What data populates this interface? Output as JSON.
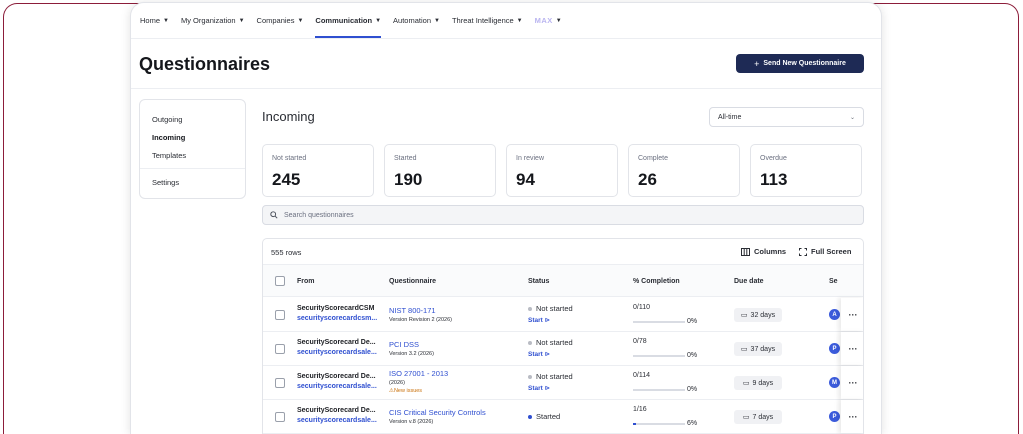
{
  "nav": {
    "items": [
      {
        "label": "Home"
      },
      {
        "label": "My Organization"
      },
      {
        "label": "Companies"
      },
      {
        "label": "Communication"
      },
      {
        "label": "Automation"
      },
      {
        "label": "Threat Intelligence"
      },
      {
        "label": "MAX"
      }
    ],
    "active": "Communication"
  },
  "page": {
    "title": "Questionnaires",
    "send_button": "Send New Questionnaire"
  },
  "sidebar": {
    "items": [
      {
        "label": "Outgoing"
      },
      {
        "label": "Incoming"
      },
      {
        "label": "Templates"
      },
      {
        "label": "Settings"
      }
    ],
    "active": "Incoming"
  },
  "main": {
    "title": "Incoming",
    "range": "All-time",
    "stats": [
      {
        "label": "Not started",
        "value": "245"
      },
      {
        "label": "Started",
        "value": "190"
      },
      {
        "label": "In review",
        "value": "94"
      },
      {
        "label": "Complete",
        "value": "26"
      },
      {
        "label": "Overdue",
        "value": "113"
      }
    ],
    "search_placeholder": "Search questionnaires"
  },
  "table": {
    "rows_count": "555 rows",
    "columns_button": "Columns",
    "fullscreen_button": "Full Screen",
    "headers": [
      "From",
      "Questionnaire",
      "Status",
      "% Completion",
      "Due date",
      "Se"
    ],
    "rows": [
      {
        "from_name": "SecurityScorecardCSM",
        "from_mail": "securityscorecardcsm...",
        "q_name": "NIST 800-171",
        "q_ver": "Version Revision 2 (2026)",
        "q_warn": "",
        "status": "Not started",
        "start": "Start ⊳",
        "count": "0/110",
        "pct": "0%",
        "progress": 0,
        "due": "32 days",
        "avatar": "A"
      },
      {
        "from_name": "SecurityScorecard De...",
        "from_mail": "securityscorecardsale...",
        "q_name": "PCI DSS",
        "q_ver": "Version 3.2 (2026)",
        "q_warn": "",
        "status": "Not started",
        "start": "Start ⊳",
        "count": "0/78",
        "pct": "0%",
        "progress": 0,
        "due": "37 days",
        "avatar": "P"
      },
      {
        "from_name": "SecurityScorecard De...",
        "from_mail": "securityscorecardsale...",
        "q_name": "ISO 27001 - 2013",
        "q_ver": "(2026)",
        "q_warn": "New issues",
        "status": "Not started",
        "start": "Start ⊳",
        "count": "0/114",
        "pct": "0%",
        "progress": 0,
        "due": "9 days",
        "avatar": "M"
      },
      {
        "from_name": "SecurityScorecard De...",
        "from_mail": "securityscorecardsale...",
        "q_name": "CIS Critical Security Controls",
        "q_ver": "Version v.8 (2026)",
        "q_warn": "",
        "status": "Started",
        "start": "",
        "count": "1/16",
        "pct": "6%",
        "progress": 0.06,
        "due": "7 days",
        "avatar": "P"
      }
    ]
  },
  "colors": {
    "accent": "#2f4fd0",
    "primary_button": "#1e2a55",
    "frame": "#8c1d3a",
    "started_dot": "#2f4fd0",
    "not_started_dot": "#b9bcc4",
    "warning": "#c9700a"
  },
  "icons": {
    "search": "search-icon",
    "columns": "columns-icon",
    "fullscreen": "fullscreen-icon",
    "calendar": "calendar-icon",
    "more": "more-icon",
    "chevron": "chevron-down-icon",
    "plus": "plus-icon"
  }
}
